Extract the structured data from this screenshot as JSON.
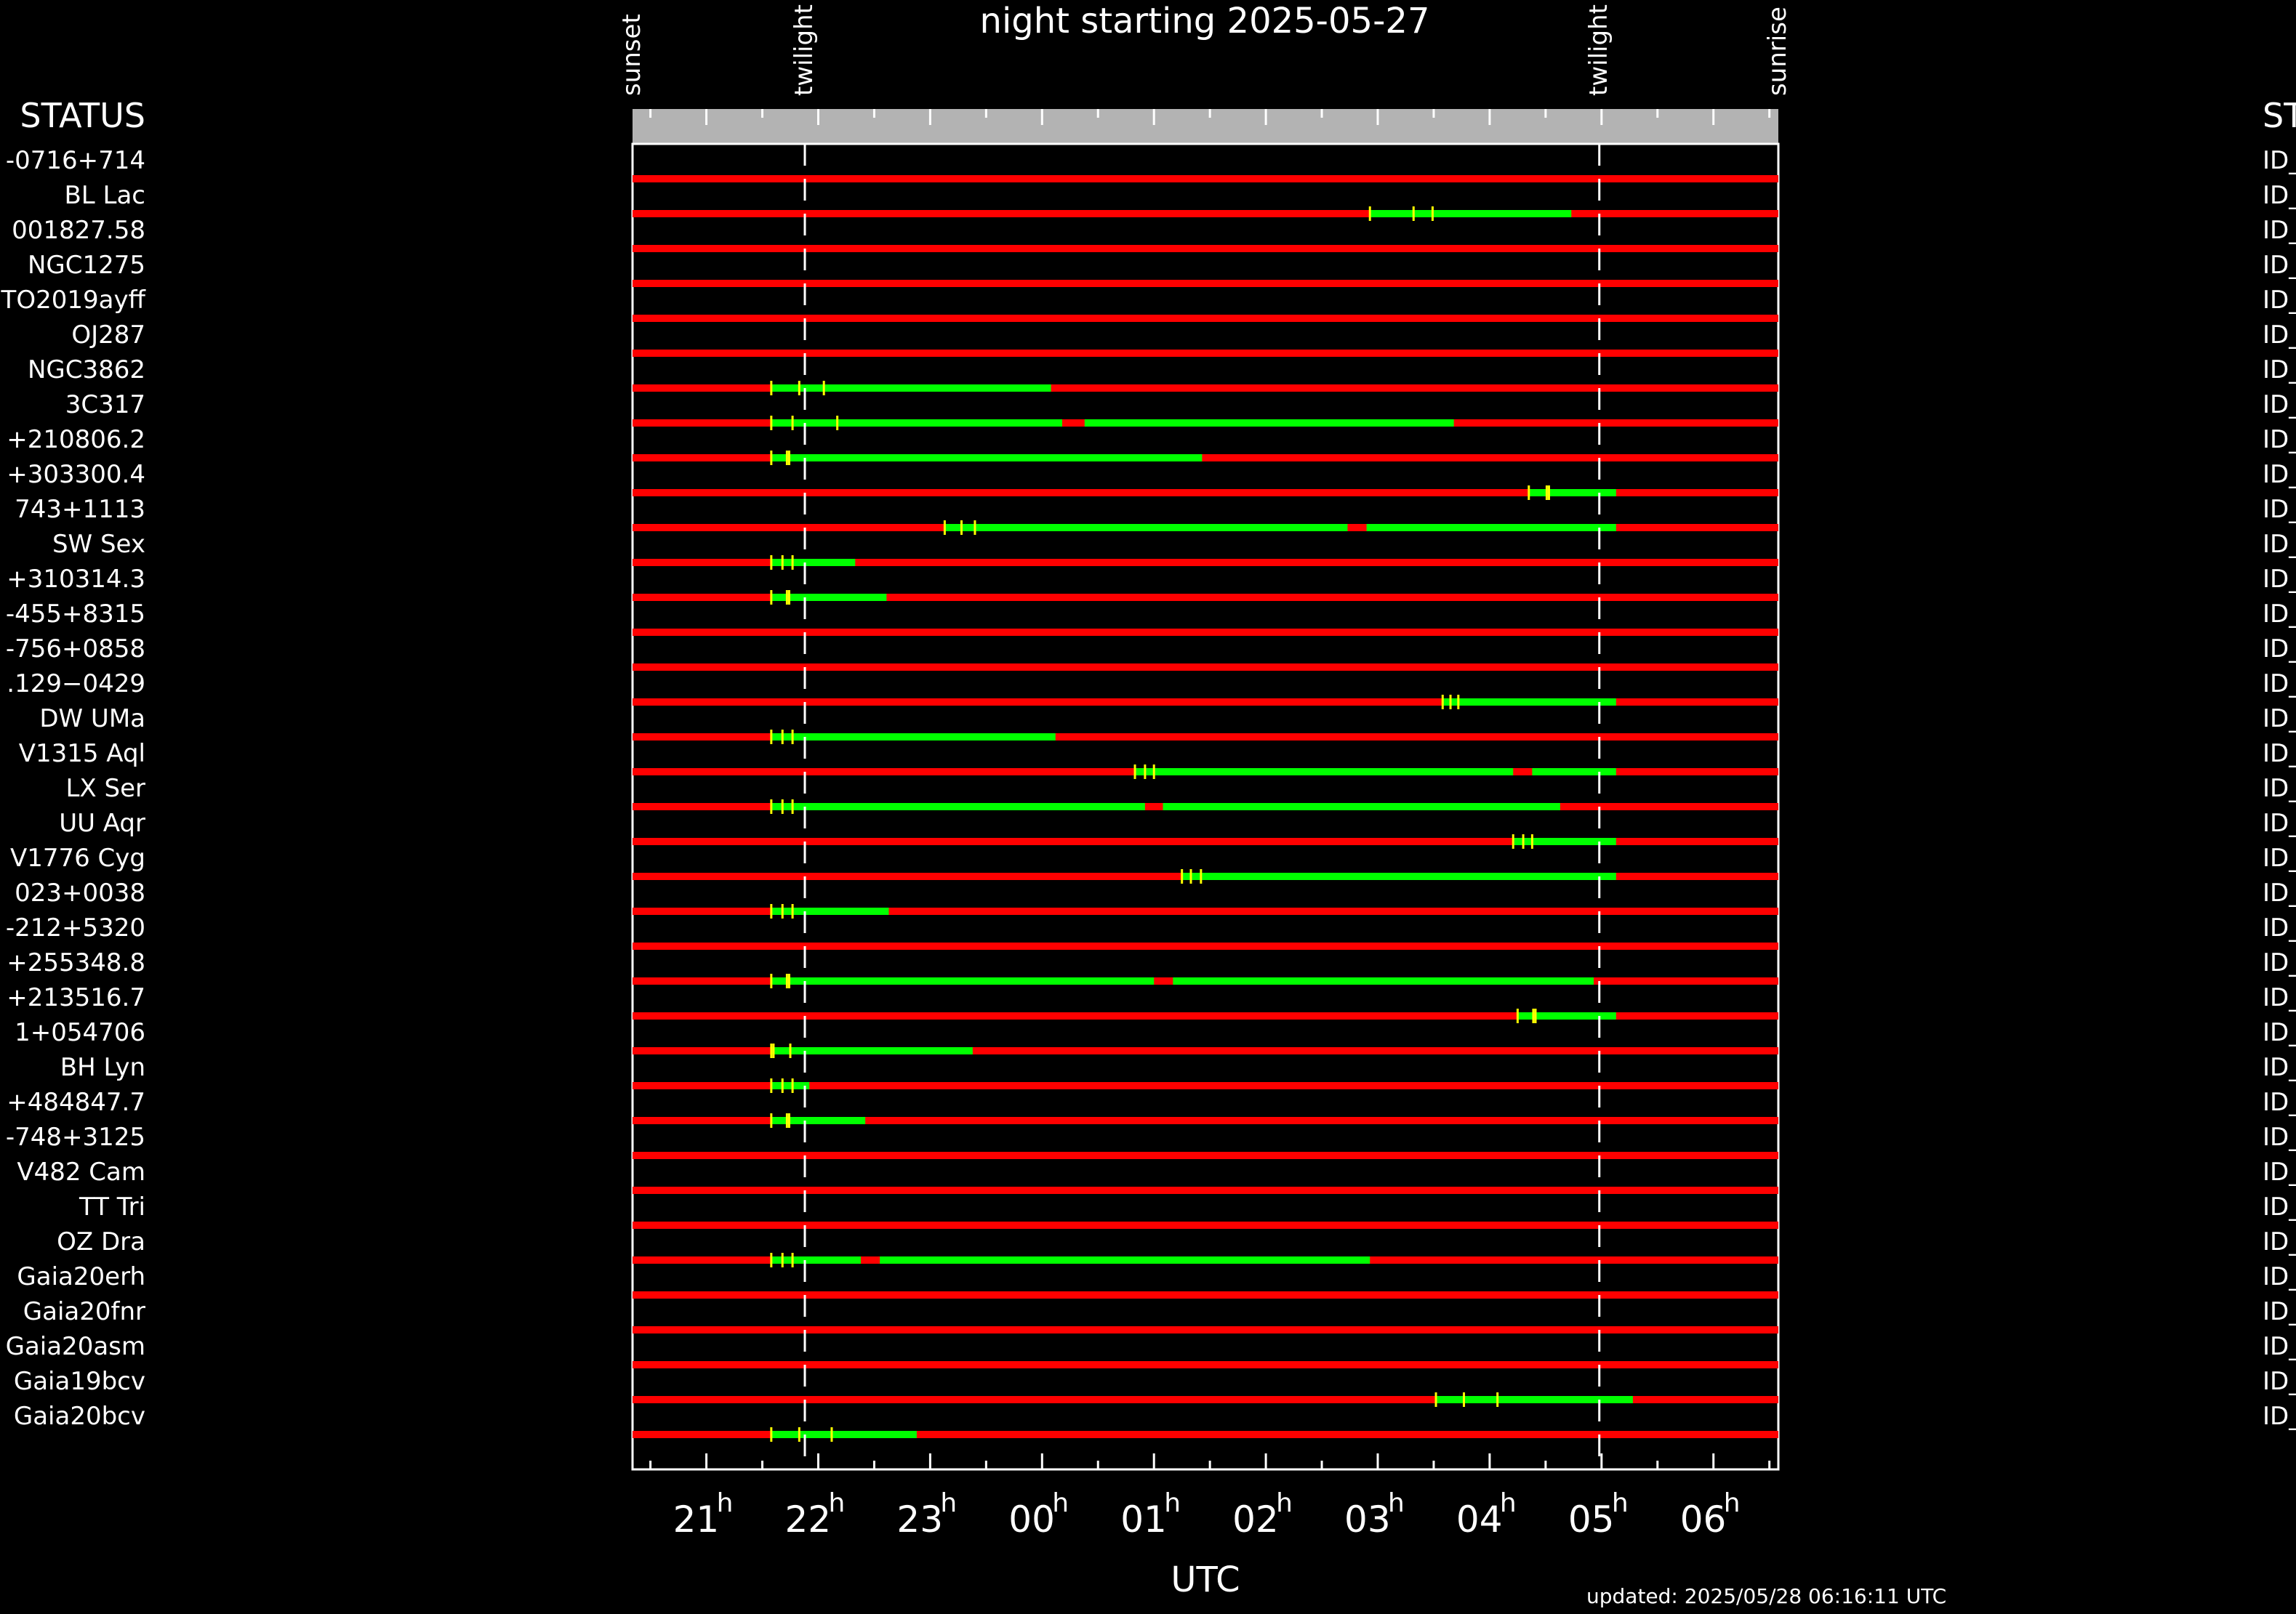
{
  "title": "night starting 2025-05-27",
  "status_header_left": "STATUS",
  "status_header_right": "ST",
  "top_markers": [
    "sunset",
    "twilight",
    "twilight",
    "sunrise"
  ],
  "xlabel": "UTC",
  "updated": "updated: 2025/05/28 06:16:11 UTC",
  "right_status_text": "ID_",
  "colors": {
    "not_observable": "#ff0000",
    "observable": "#00ff00",
    "marker": "#ffff00",
    "header_bar": "#b3b3b3"
  },
  "chart_data": {
    "type": "timeline",
    "x_axis": {
      "unit": "UTC hours",
      "range": [
        20.34,
        6.58
      ],
      "tick_labels": [
        {
          "h": 21,
          "label": "21",
          "sup": "h"
        },
        {
          "h": 22,
          "label": "22",
          "sup": "h"
        },
        {
          "h": 23,
          "label": "23",
          "sup": "h"
        },
        {
          "h": 24,
          "label": "00",
          "sup": "h"
        },
        {
          "h": 25,
          "label": "01",
          "sup": "h"
        },
        {
          "h": 26,
          "label": "02",
          "sup": "h"
        },
        {
          "h": 27,
          "label": "03",
          "sup": "h"
        },
        {
          "h": 28,
          "label": "04",
          "sup": "h"
        },
        {
          "h": 29,
          "label": "05",
          "sup": "h"
        },
        {
          "h": 30,
          "label": "06",
          "sup": "h"
        }
      ]
    },
    "events": [
      {
        "name": "sunset",
        "h": 20.34
      },
      {
        "name": "twilight",
        "h": 21.88
      },
      {
        "name": "twilight",
        "h": 28.98
      },
      {
        "name": "sunrise",
        "h": 30.58
      }
    ],
    "rows": [
      {
        "label": "-0716+714",
        "green": [],
        "ticks": []
      },
      {
        "label": "BL Lac",
        "green": [
          [
            26.93,
            28.73
          ]
        ],
        "ticks": [
          26.93,
          27.32,
          27.49
        ]
      },
      {
        "label": "001827.58",
        "green": [],
        "ticks": []
      },
      {
        "label": "NGC1275",
        "green": [],
        "ticks": []
      },
      {
        "label": "TO2019ayff",
        "green": [],
        "ticks": []
      },
      {
        "label": "OJ287",
        "green": [],
        "ticks": []
      },
      {
        "label": "NGC3862",
        "green": [
          [
            21.58,
            24.08
          ]
        ],
        "ticks": [
          21.58,
          21.83,
          22.05
        ]
      },
      {
        "label": "3C317",
        "green": [
          [
            21.58,
            24.18
          ],
          [
            24.38,
            27.68
          ]
        ],
        "ticks": [
          21.58,
          21.77,
          22.17
        ]
      },
      {
        "label": "+210806.2",
        "green": [
          [
            21.58,
            25.43
          ]
        ],
        "ticks": [
          21.58,
          21.72,
          21.74
        ]
      },
      {
        "label": "+303300.4",
        "green": [
          [
            28.35,
            29.13
          ]
        ],
        "ticks": [
          28.35,
          28.51,
          28.53
        ]
      },
      {
        "label": "743+1113",
        "green": [
          [
            23.13,
            26.73
          ],
          [
            26.9,
            29.13
          ]
        ],
        "ticks": [
          23.13,
          23.28,
          23.4
        ]
      },
      {
        "label": "SW Sex",
        "green": [
          [
            21.58,
            22.33
          ]
        ],
        "ticks": [
          21.58,
          21.68,
          21.77
        ]
      },
      {
        "label": "+310314.3",
        "green": [
          [
            21.58,
            22.61
          ]
        ],
        "ticks": [
          21.58,
          21.72,
          21.74
        ]
      },
      {
        "label": "-455+8315",
        "green": [],
        "ticks": []
      },
      {
        "label": "-756+0858",
        "green": [],
        "ticks": []
      },
      {
        "label": ".129−0429",
        "green": [
          [
            27.58,
            29.13
          ]
        ],
        "ticks": [
          27.58,
          27.65,
          27.72
        ]
      },
      {
        "label": "DW UMa",
        "green": [
          [
            21.58,
            24.12
          ]
        ],
        "ticks": [
          21.58,
          21.68,
          21.77
        ]
      },
      {
        "label": "V1315 Aql",
        "green": [
          [
            24.83,
            28.21
          ],
          [
            28.38,
            29.13
          ]
        ],
        "ticks": [
          24.83,
          24.92,
          25.0
        ]
      },
      {
        "label": "LX Ser",
        "green": [
          [
            21.58,
            24.92
          ],
          [
            25.08,
            28.63
          ]
        ],
        "ticks": [
          21.58,
          21.68,
          21.77
        ]
      },
      {
        "label": "UU Aqr",
        "green": [
          [
            28.21,
            29.13
          ]
        ],
        "ticks": [
          28.21,
          28.3,
          28.38
        ]
      },
      {
        "label": "V1776 Cyg",
        "green": [
          [
            25.25,
            29.13
          ]
        ],
        "ticks": [
          25.25,
          25.33,
          25.42
        ]
      },
      {
        "label": "023+0038",
        "green": [
          [
            21.58,
            22.63
          ]
        ],
        "ticks": [
          21.58,
          21.68,
          21.77
        ]
      },
      {
        "label": "-212+5320",
        "green": [],
        "ticks": []
      },
      {
        "label": "+255348.8",
        "green": [
          [
            21.58,
            25.0
          ],
          [
            25.17,
            28.93
          ]
        ],
        "ticks": [
          21.58,
          21.72,
          21.74
        ]
      },
      {
        "label": "+213516.7",
        "green": [
          [
            28.25,
            29.13
          ]
        ],
        "ticks": [
          28.25,
          28.39,
          28.41
        ]
      },
      {
        "label": "1+054706",
        "green": [
          [
            21.58,
            23.38
          ]
        ],
        "ticks": [
          21.58,
          21.6,
          21.75
        ]
      },
      {
        "label": "BH Lyn",
        "green": [
          [
            21.58,
            21.92
          ]
        ],
        "ticks": [
          21.58,
          21.68,
          21.77
        ]
      },
      {
        "label": "+484847.7",
        "green": [
          [
            21.58,
            22.42
          ]
        ],
        "ticks": [
          21.58,
          21.72,
          21.74
        ]
      },
      {
        "label": "-748+3125",
        "green": [],
        "ticks": []
      },
      {
        "label": "V482 Cam",
        "green": [],
        "ticks": []
      },
      {
        "label": "TT Tri",
        "green": [],
        "ticks": []
      },
      {
        "label": "OZ Dra",
        "green": [
          [
            21.58,
            22.38
          ],
          [
            22.55,
            26.93
          ]
        ],
        "ticks": [
          21.58,
          21.68,
          21.77
        ]
      },
      {
        "label": "Gaia20erh",
        "green": [],
        "ticks": []
      },
      {
        "label": "Gaia20fnr",
        "green": [],
        "ticks": []
      },
      {
        "label": "Gaia20asm",
        "green": [],
        "ticks": []
      },
      {
        "label": "Gaia19bcv",
        "green": [
          [
            27.52,
            29.28
          ]
        ],
        "ticks": [
          27.52,
          27.77,
          28.07
        ]
      },
      {
        "label": "Gaia20bcv",
        "green": [
          [
            21.58,
            22.88
          ]
        ],
        "ticks": [
          21.58,
          21.83,
          22.12
        ]
      }
    ]
  }
}
